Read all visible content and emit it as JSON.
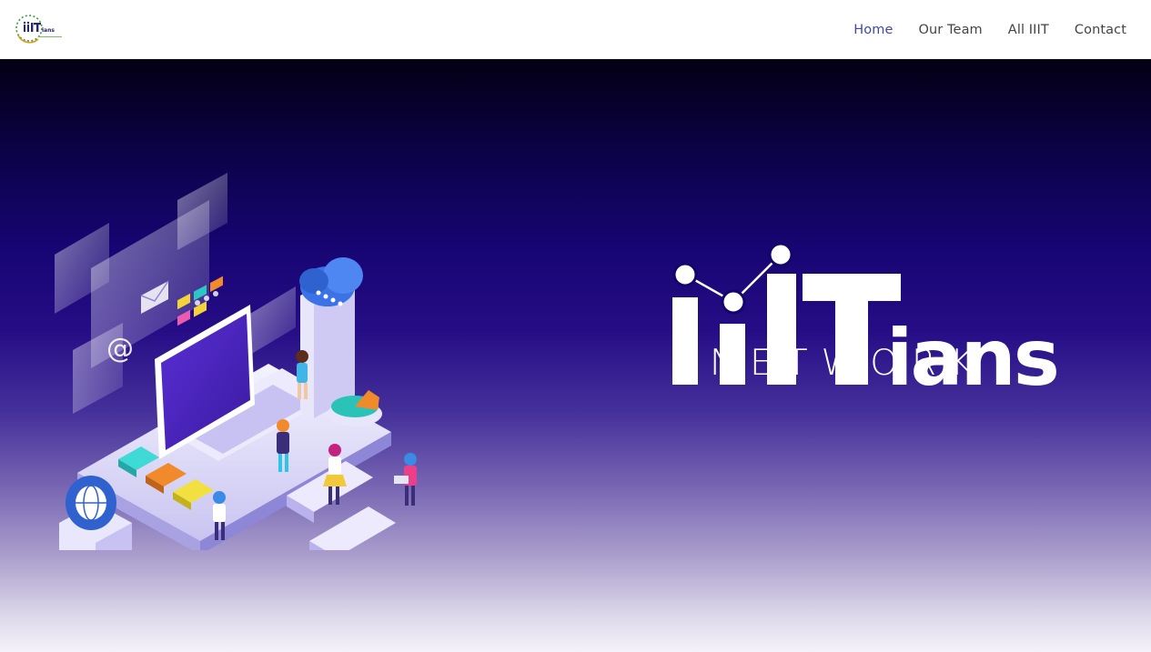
{
  "header": {
    "logo": {
      "name": "IIITians logo",
      "wordmark": "iiITians"
    },
    "nav": [
      {
        "label": "Home",
        "active": true
      },
      {
        "label": "Our Team",
        "active": false
      },
      {
        "label": "All IIIT",
        "active": false
      },
      {
        "label": "Contact",
        "active": false
      }
    ]
  },
  "hero": {
    "illustration": "isometric-laptop-network-illustration",
    "brand": {
      "wordmark_prefix": "i",
      "wordmark_main": "ians",
      "subtitle": "NETWORK"
    }
  },
  "colors": {
    "nav_active": "#3f4aa6",
    "nav_text": "#444444",
    "hero_top": "#040013",
    "hero_mid": "#170573",
    "hero_bottom": "#f4f2f9",
    "brand_text": "#ffffff"
  }
}
